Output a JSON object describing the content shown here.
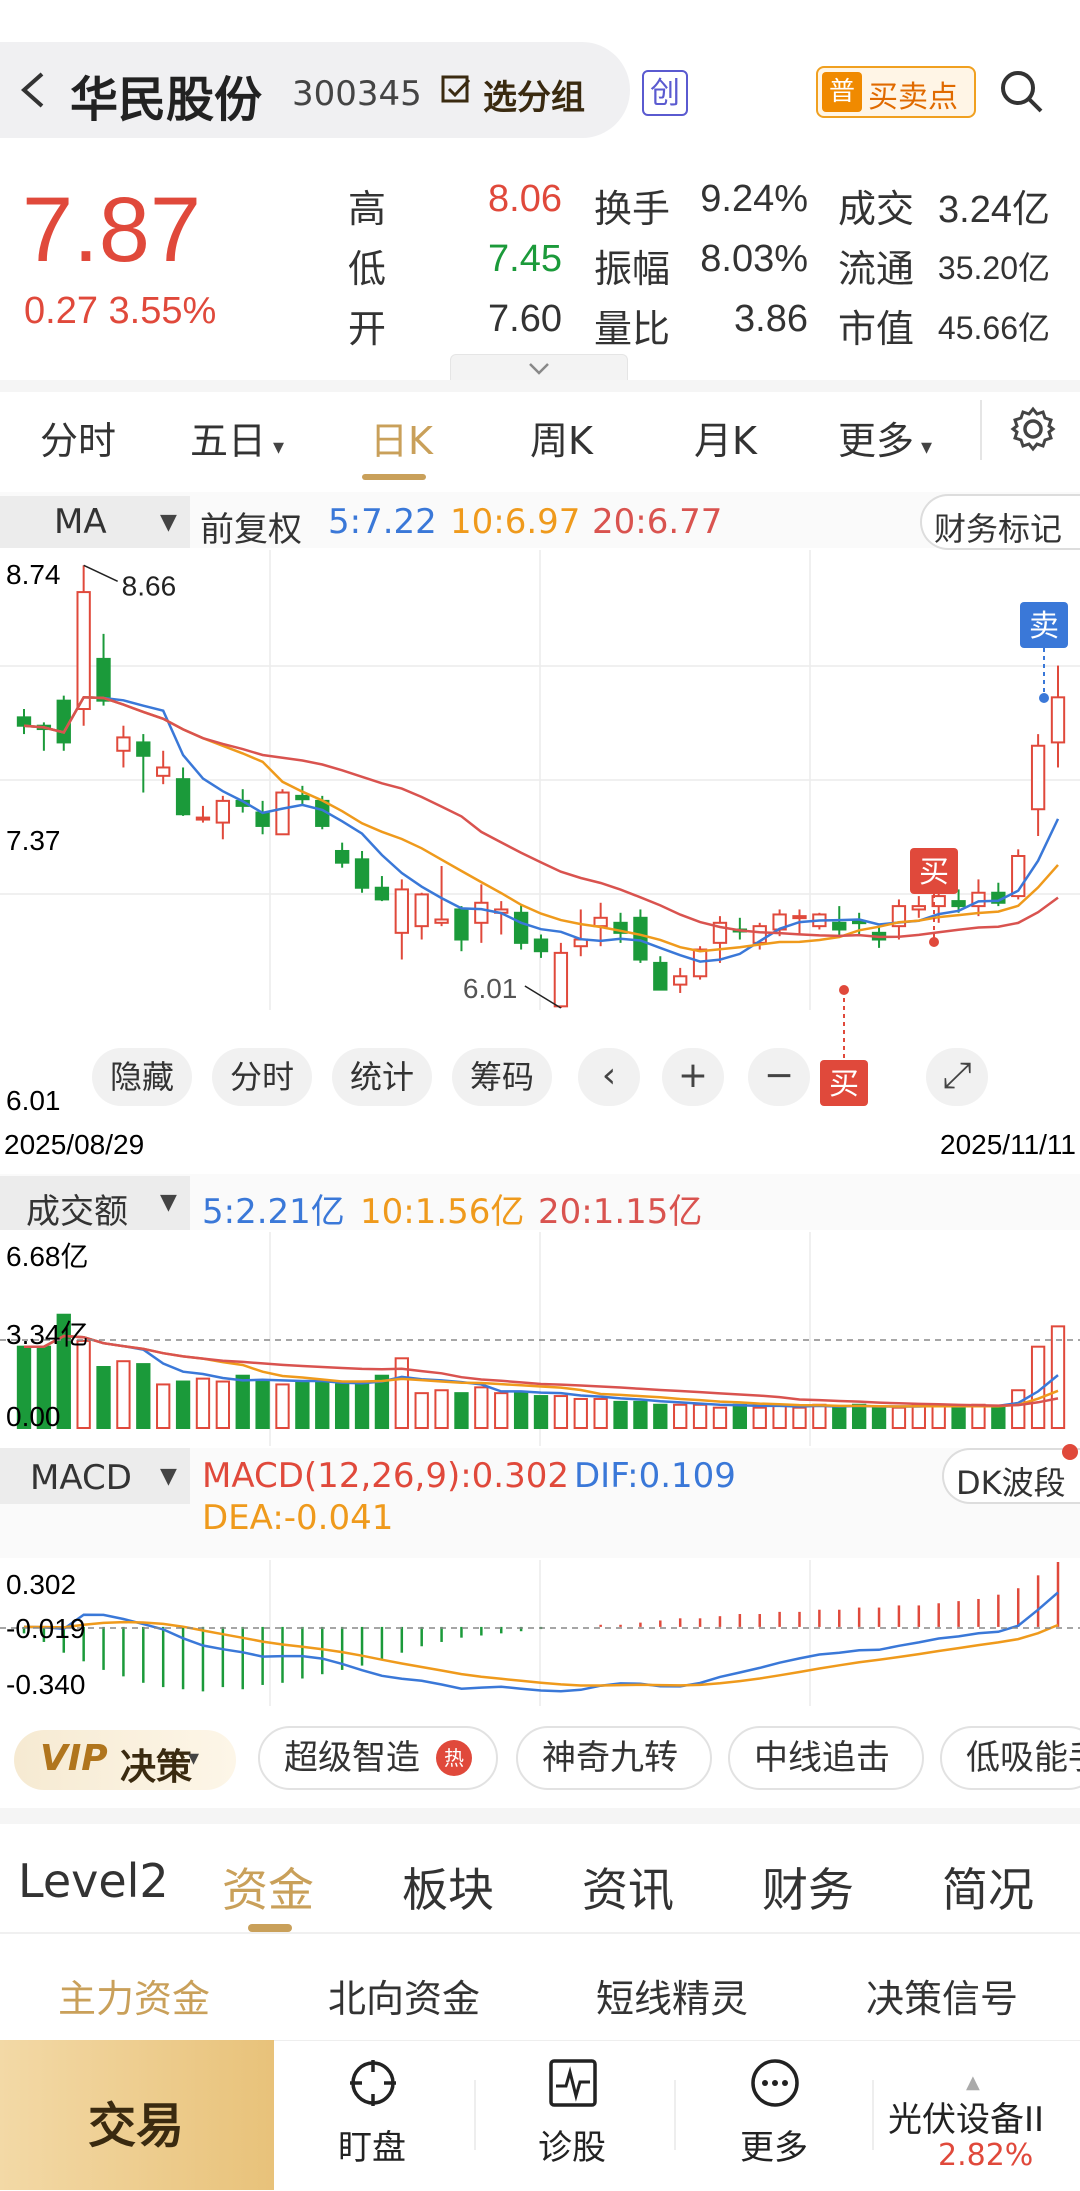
{
  "header": {
    "stock_name": "华民股份",
    "stock_code": "300345",
    "watchlist_label": "选分组",
    "board_badge": "创",
    "buy_sell_tag": "普",
    "buy_sell_label": "买卖点"
  },
  "quote": {
    "price": "7.87",
    "change": "0.27 3.55%",
    "rows": [
      {
        "l1": "高",
        "v1": "8.06",
        "l2": "换手",
        "v2": "9.24%",
        "l3": "成交",
        "v3": "3.24亿"
      },
      {
        "l1": "低",
        "v1": "7.45",
        "l2": "振幅",
        "v2": "8.03%",
        "l3": "流通",
        "v3": "35.20亿"
      },
      {
        "l1": "开",
        "v1": "7.60",
        "l2": "量比",
        "v2": "3.86",
        "l3": "市值",
        "v3": "45.66亿"
      }
    ]
  },
  "period_tabs": [
    "分时",
    "五日",
    "日K",
    "周K",
    "月K",
    "更多"
  ],
  "active_period": "日K",
  "ma_bar": {
    "type": "MA",
    "adjust": "前复权",
    "ma5": "5:7.22",
    "ma10": "10:6.97",
    "ma20": "20:6.77",
    "finance_mark": "财务标记"
  },
  "kline": {
    "y_max_label": "8.74",
    "y_mid_label": "7.37",
    "y_min_label": "6.01",
    "high_marker": "8.66",
    "low_marker": "6.01",
    "date_start": "2025/08/29",
    "date_end": "2025/11/11",
    "sell_tag": "卖",
    "buy_tag": "买",
    "buy_tag2": "买"
  },
  "chart_tools": [
    "隐藏",
    "分时",
    "统计",
    "筹码"
  ],
  "volume": {
    "label": "成交额",
    "ma5": "5:2.21亿",
    "ma10": "10:1.56亿",
    "ma20": "20:1.15亿",
    "y_max_label": "6.68亿",
    "y_ref_label": "3.34亿",
    "y_min_label": "0.00"
  },
  "macd": {
    "label": "MACD",
    "macd_val": "MACD(12,26,9):0.302",
    "dif": "DIF:0.109",
    "dea": "DEA:-0.041",
    "y_top": "0.302",
    "y_zero": "-0.019",
    "y_bot": "-0.340",
    "dk_label": "DK波段"
  },
  "decision": {
    "vip_label": "VIP",
    "vip_decision": "决策",
    "hot_badge": "热",
    "chips": [
      "超级智造",
      "神奇九转",
      "中线追击",
      "低吸能手"
    ]
  },
  "section_tabs": [
    "Level2",
    "资金",
    "板块",
    "资讯",
    "财务",
    "简况"
  ],
  "active_section": "资金",
  "sub_tabs": [
    "主力资金",
    "北向资金",
    "短线精灵",
    "决策信号"
  ],
  "bottom_nav": {
    "trade": "交易",
    "items": [
      "盯盘",
      "诊股",
      "更多"
    ],
    "sector_name": "光伏设备II",
    "sector_pct": "2.82%"
  },
  "colors": {
    "up": "#e0493b",
    "down": "#1b9a3a",
    "ma5": "#3a78d8",
    "ma10": "#ef9a1c",
    "ma20": "#d9534f",
    "accent": "#c9a05a"
  },
  "chart_data": [
    {
      "type": "candlestick",
      "x_range": [
        "2025/08/29",
        "2025/11/11"
      ],
      "ylim": [
        6.01,
        8.74
      ],
      "ohlc": [
        [
          7.75,
          7.8,
          7.65,
          7.7
        ],
        [
          7.7,
          7.72,
          7.55,
          7.68
        ],
        [
          7.85,
          7.88,
          7.55,
          7.6
        ],
        [
          7.8,
          8.66,
          7.7,
          8.5
        ],
        [
          8.1,
          8.25,
          7.82,
          7.85
        ],
        [
          7.55,
          7.7,
          7.45,
          7.63
        ],
        [
          7.6,
          7.65,
          7.3,
          7.52
        ],
        [
          7.4,
          7.55,
          7.35,
          7.45
        ],
        [
          7.38,
          7.45,
          7.16,
          7.17
        ],
        [
          7.15,
          7.22,
          7.12,
          7.15
        ],
        [
          7.12,
          7.28,
          7.02,
          7.25
        ],
        [
          7.25,
          7.32,
          7.18,
          7.22
        ],
        [
          7.18,
          7.25,
          7.05,
          7.1
        ],
        [
          7.05,
          7.32,
          7.05,
          7.3
        ],
        [
          7.28,
          7.34,
          7.22,
          7.26
        ],
        [
          7.25,
          7.28,
          7.08,
          7.1
        ],
        [
          6.95,
          7.0,
          6.85,
          6.88
        ],
        [
          6.9,
          6.95,
          6.7,
          6.73
        ],
        [
          6.73,
          6.8,
          6.65,
          6.66
        ],
        [
          6.46,
          6.78,
          6.3,
          6.72
        ],
        [
          6.5,
          6.7,
          6.42,
          6.69
        ],
        [
          6.52,
          6.86,
          6.5,
          6.54
        ],
        [
          6.6,
          6.62,
          6.35,
          6.42
        ],
        [
          6.52,
          6.75,
          6.4,
          6.64
        ],
        [
          6.58,
          6.65,
          6.45,
          6.6
        ],
        [
          6.58,
          6.63,
          6.36,
          6.4
        ],
        [
          6.42,
          6.45,
          6.31,
          6.35
        ],
        [
          6.02,
          6.4,
          6.01,
          6.34
        ],
        [
          6.38,
          6.6,
          6.32,
          6.42
        ],
        [
          6.5,
          6.64,
          6.38,
          6.55
        ],
        [
          6.52,
          6.58,
          6.4,
          6.46
        ],
        [
          6.55,
          6.6,
          6.28,
          6.3
        ],
        [
          6.28,
          6.32,
          6.12,
          6.12
        ],
        [
          6.15,
          6.25,
          6.1,
          6.2
        ],
        [
          6.2,
          6.38,
          6.18,
          6.36
        ],
        [
          6.4,
          6.56,
          6.28,
          6.52
        ],
        [
          6.48,
          6.55,
          6.42,
          6.47
        ],
        [
          6.4,
          6.52,
          6.36,
          6.5
        ],
        [
          6.48,
          6.6,
          6.44,
          6.57
        ],
        [
          6.55,
          6.6,
          6.45,
          6.56
        ],
        [
          6.5,
          6.58,
          6.48,
          6.57
        ],
        [
          6.52,
          6.62,
          6.44,
          6.48
        ],
        [
          6.53,
          6.58,
          6.45,
          6.52
        ],
        [
          6.46,
          6.5,
          6.37,
          6.42
        ],
        [
          6.5,
          6.66,
          6.42,
          6.62
        ],
        [
          6.6,
          6.68,
          6.55,
          6.62
        ],
        [
          6.62,
          6.72,
          6.52,
          6.68
        ],
        [
          6.65,
          6.72,
          6.58,
          6.62
        ],
        [
          6.62,
          6.78,
          6.56,
          6.7
        ],
        [
          6.7,
          6.76,
          6.62,
          6.64
        ],
        [
          6.68,
          6.96,
          6.66,
          6.92
        ],
        [
          7.2,
          7.65,
          7.04,
          7.58
        ],
        [
          7.6,
          8.06,
          7.45,
          7.87
        ]
      ],
      "ma5": "7.22",
      "ma10": "6.97",
      "ma20": "6.77"
    },
    {
      "type": "bar",
      "title": "成交额",
      "ylim": [
        0.0,
        6.68
      ],
      "unit": "亿",
      "values": [
        2.8,
        2.8,
        3.9,
        3.0,
        2.1,
        2.3,
        2.2,
        1.5,
        1.6,
        1.7,
        1.6,
        1.8,
        1.6,
        1.5,
        1.6,
        1.6,
        1.5,
        1.5,
        1.8,
        2.4,
        1.2,
        1.3,
        1.2,
        1.4,
        1.2,
        1.2,
        1.1,
        1.1,
        1.0,
        1.0,
        0.9,
        0.9,
        0.8,
        0.8,
        0.8,
        0.7,
        0.8,
        0.7,
        0.8,
        0.7,
        0.8,
        0.7,
        0.8,
        0.7,
        0.7,
        0.8,
        0.8,
        0.7,
        0.8,
        0.7,
        1.3,
        2.8,
        3.5
      ],
      "series": [
        {
          "name": "5",
          "last": "2.21亿"
        },
        {
          "name": "10",
          "last": "1.56亿"
        },
        {
          "name": "20",
          "last": "1.15亿"
        }
      ]
    },
    {
      "type": "bar",
      "title": "MACD(12,26,9)",
      "ylim": [
        -0.34,
        0.302
      ],
      "values": [
        -0.03,
        -0.07,
        -0.12,
        -0.16,
        -0.2,
        -0.23,
        -0.26,
        -0.28,
        -0.29,
        -0.3,
        -0.28,
        -0.29,
        -0.27,
        -0.26,
        -0.24,
        -0.22,
        -0.2,
        -0.18,
        -0.15,
        -0.12,
        -0.09,
        -0.07,
        -0.05,
        -0.04,
        -0.03,
        -0.02,
        -0.01,
        0.0,
        0.0,
        0.01,
        0.01,
        0.02,
        0.03,
        0.04,
        0.04,
        0.05,
        0.06,
        0.06,
        0.07,
        0.07,
        0.08,
        0.08,
        0.09,
        0.09,
        0.1,
        0.1,
        0.11,
        0.12,
        0.13,
        0.15,
        0.18,
        0.24,
        0.302
      ],
      "dif": "0.109",
      "dea": "-0.041"
    }
  ]
}
